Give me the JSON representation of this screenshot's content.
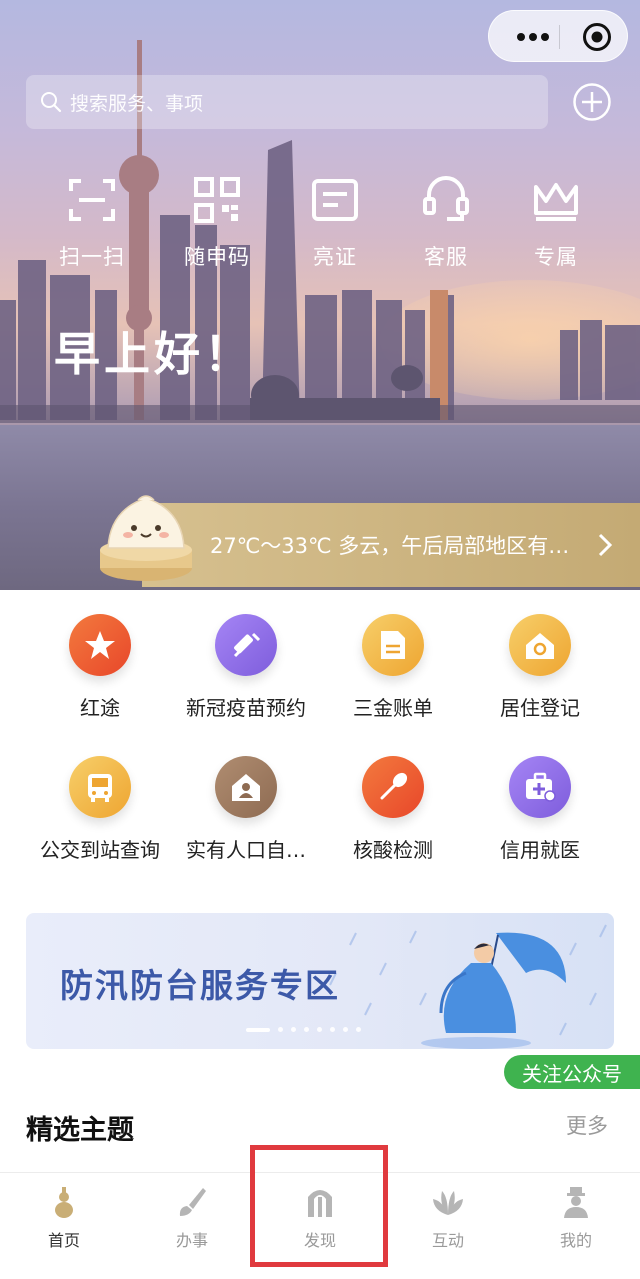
{
  "capsule": {
    "more_icon": "ellipsis-icon",
    "close_icon": "target-close-icon"
  },
  "search": {
    "placeholder": "搜索服务、事项",
    "icon": "search-icon"
  },
  "quick_actions": [
    {
      "label": "扫一扫",
      "icon": "scan-icon"
    },
    {
      "label": "随申码",
      "icon": "qr-code-icon"
    },
    {
      "label": "亮证",
      "icon": "id-card-icon"
    },
    {
      "label": "客服",
      "icon": "headset-icon"
    },
    {
      "label": "专属",
      "icon": "crown-icon"
    }
  ],
  "greeting": "早上好！",
  "weather": {
    "text": "27℃～33℃ 多云，午后局部地区有…"
  },
  "services": [
    {
      "label": "红途",
      "icon": "star-flag-icon",
      "color": "#ee5b2c"
    },
    {
      "label": "新冠疫苗预约",
      "icon": "syringe-icon",
      "color": "#8f6fe8"
    },
    {
      "label": "三金账单",
      "icon": "bill-icon",
      "color": "#f3b441"
    },
    {
      "label": "居住登记",
      "icon": "home-icon",
      "color": "#f3b441"
    },
    {
      "label": "公交到站查询",
      "icon": "bus-icon",
      "color": "#f3b441"
    },
    {
      "label": "实有人口自…",
      "icon": "person-house-icon",
      "color": "#9b7a62"
    },
    {
      "label": "核酸检测",
      "icon": "swab-icon",
      "color": "#ee5b2c"
    },
    {
      "label": "信用就医",
      "icon": "medical-kit-icon",
      "color": "#8f6fe8"
    }
  ],
  "banner": {
    "title": "防汛防台服务专区",
    "slides": 8,
    "active_slide": 1
  },
  "follow_button": "关注公众号",
  "featured": {
    "title": "精选主题",
    "more": "更多"
  },
  "tabbar": [
    {
      "label": "首页",
      "icon": "gourd-icon",
      "active": true
    },
    {
      "label": "办事",
      "icon": "brush-icon",
      "active": false
    },
    {
      "label": "发现",
      "icon": "gate-icon",
      "active": false
    },
    {
      "label": "互动",
      "icon": "magnolia-icon",
      "active": false
    },
    {
      "label": "我的",
      "icon": "person-icon",
      "active": false
    }
  ],
  "colors": {
    "brand_gold": "#c9ae76",
    "follow_green": "#3fb34f",
    "banner_title": "#3c59a8",
    "highlight_red": "#e03a3e"
  }
}
